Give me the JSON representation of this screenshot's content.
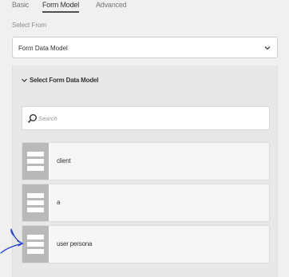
{
  "tabs": [
    {
      "label": "Basic"
    },
    {
      "label": "Form Model",
      "active": true
    },
    {
      "label": "Advanced"
    }
  ],
  "select_from": {
    "label": "Select From",
    "value": "Form Data Model"
  },
  "panel": {
    "title": "Select Form Data Model",
    "search_placeholder": "Search",
    "items": [
      {
        "label": "client",
        "icon": "data-model-icon"
      },
      {
        "label": "a",
        "icon": "data-model-icon"
      },
      {
        "label": "user persona",
        "icon": "data-model-icon"
      }
    ]
  },
  "colors": {
    "accent": "#505050",
    "icon_tile": "#b9b9b9",
    "annotation": "#1a3ccc"
  }
}
